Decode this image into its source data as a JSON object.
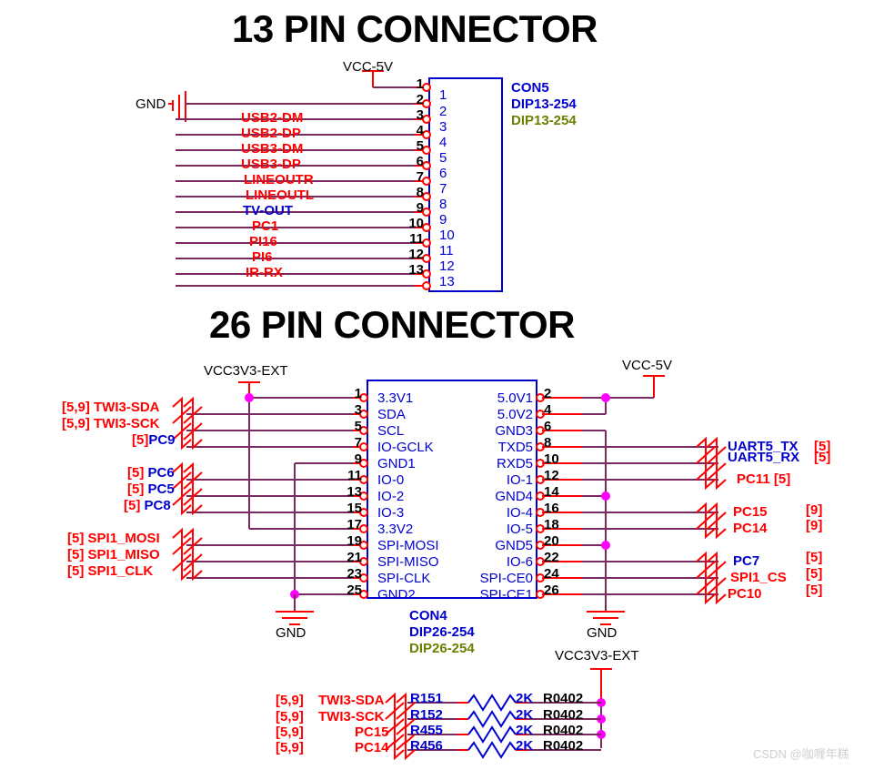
{
  "sheet": {
    "watermark": "CSDN @咖喱年糕",
    "titles": {
      "connector13": "13 PIN CONNECTOR",
      "connector26": "26 PIN CONNECTOR"
    }
  },
  "connector13": {
    "designator": "CON5",
    "part": "DIP13-254",
    "footprint": "DIP13-254",
    "power_label": "VCC-5V",
    "gnd_label": "GND",
    "pins": [
      {
        "num": "1",
        "inner": "1",
        "net": "",
        "net_color": "red"
      },
      {
        "num": "2",
        "inner": "2",
        "net": "",
        "net_color": "red"
      },
      {
        "num": "3",
        "inner": "3",
        "net": "USB2-DM",
        "net_color": "red"
      },
      {
        "num": "4",
        "inner": "4",
        "net": "USB2-DP",
        "net_color": "red"
      },
      {
        "num": "5",
        "inner": "5",
        "net": "USB3-DM",
        "net_color": "red"
      },
      {
        "num": "6",
        "inner": "6",
        "net": "USB3-DP",
        "net_color": "red"
      },
      {
        "num": "7",
        "inner": "7",
        "net": "LINEOUTR",
        "net_color": "red"
      },
      {
        "num": "8",
        "inner": "8",
        "net": "LINEOUTL",
        "net_color": "red"
      },
      {
        "num": "9",
        "inner": "9",
        "net": "TV-OUT",
        "net_color": "blue"
      },
      {
        "num": "10",
        "inner": "10",
        "net": "PC1",
        "net_color": "red"
      },
      {
        "num": "11",
        "inner": "11",
        "net": "PI16",
        "net_color": "red"
      },
      {
        "num": "12",
        "inner": "12",
        "net": "PI6",
        "net_color": "red"
      },
      {
        "num": "13",
        "inner": "13",
        "net": "IR-RX",
        "net_color": "red"
      }
    ]
  },
  "connector26": {
    "designator": "CON4",
    "part": "DIP26-254",
    "footprint": "DIP26-254",
    "power_left_label": "VCC3V3-EXT",
    "power_right_label": "VCC-5V",
    "gnd_left_label": "GND",
    "gnd_right_label": "GND",
    "left_pins": [
      {
        "num": "1",
        "name": "3.3V1"
      },
      {
        "num": "3",
        "name": "SDA"
      },
      {
        "num": "5",
        "name": "SCL"
      },
      {
        "num": "7",
        "name": "IO-GCLK"
      },
      {
        "num": "9",
        "name": "GND1"
      },
      {
        "num": "11",
        "name": "IO-0"
      },
      {
        "num": "13",
        "name": "IO-2"
      },
      {
        "num": "15",
        "name": "IO-3"
      },
      {
        "num": "17",
        "name": "3.3V2"
      },
      {
        "num": "19",
        "name": "SPI-MOSI"
      },
      {
        "num": "21",
        "name": "SPI-MISO"
      },
      {
        "num": "23",
        "name": "SPI-CLK"
      },
      {
        "num": "25",
        "name": "GND2"
      }
    ],
    "right_pins": [
      {
        "num": "2",
        "name": "5.0V1"
      },
      {
        "num": "4",
        "name": "5.0V2"
      },
      {
        "num": "6",
        "name": "GND3"
      },
      {
        "num": "8",
        "name": "TXD5"
      },
      {
        "num": "10",
        "name": "RXD5"
      },
      {
        "num": "12",
        "name": "IO-1"
      },
      {
        "num": "14",
        "name": "GND4"
      },
      {
        "num": "16",
        "name": "IO-4"
      },
      {
        "num": "18",
        "name": "IO-5"
      },
      {
        "num": "20",
        "name": "GND5"
      },
      {
        "num": "22",
        "name": "IO-6"
      },
      {
        "num": "24",
        "name": "SPI-CE0"
      },
      {
        "num": "26",
        "name": "SPI-CE1"
      }
    ],
    "left_nets": [
      {
        "ref": "[5,9]",
        "name": "TWI3-SDA",
        "name_color": "red",
        "pin": "3"
      },
      {
        "ref": "[5,9]",
        "name": "TWI3-SCK",
        "name_color": "red",
        "pin": "5"
      },
      {
        "ref": "[5]",
        "name": "PC9",
        "name_color": "blue",
        "pin": "7"
      },
      {
        "ref": "[5]",
        "name": "PC6",
        "name_color": "blue",
        "pin": "11"
      },
      {
        "ref": "[5]",
        "name": "PC5",
        "name_color": "blue",
        "pin": "13"
      },
      {
        "ref": "[5]",
        "name": "PC8",
        "name_color": "blue",
        "pin": "15"
      },
      {
        "ref": "[5]",
        "name": "SPI1_MOSI",
        "name_color": "red",
        "pin": "19"
      },
      {
        "ref": "[5]",
        "name": "SPI1_MISO",
        "name_color": "red",
        "pin": "21"
      },
      {
        "ref": "[5]",
        "name": "SPI1_CLK",
        "name_color": "red",
        "pin": "23"
      }
    ],
    "right_nets": [
      {
        "name": "UART5_TX",
        "name_color": "blue",
        "ref": "[5]",
        "pin": "8"
      },
      {
        "name": "UART5_RX",
        "name_color": "blue",
        "ref": "[5]",
        "pin": "10"
      },
      {
        "name": "PC11 [5]",
        "name_color": "red",
        "ref": "",
        "pin": "12"
      },
      {
        "name": "PC15",
        "name_color": "red",
        "ref": "[9]",
        "pin": "16"
      },
      {
        "name": "PC14",
        "name_color": "red",
        "ref": "[9]",
        "pin": "18"
      },
      {
        "name": "PC7",
        "name_color": "blue",
        "ref": "[5]",
        "pin": "22"
      },
      {
        "name": "SPI1_CS",
        "name_color": "red",
        "ref": "[5]",
        "pin": "24"
      },
      {
        "name": "PC10",
        "name_color": "red",
        "ref": "[5]",
        "pin": "26"
      }
    ]
  },
  "pullups": {
    "power_label": "VCC3V3-EXT",
    "rows": [
      {
        "ref": "[5,9]",
        "net": "TWI3-SDA",
        "desig": "R151",
        "value": "2K",
        "footprint": "R0402"
      },
      {
        "ref": "[5,9]",
        "net": "TWI3-SCK",
        "desig": "R152",
        "value": "2K",
        "footprint": "R0402"
      },
      {
        "ref": "[5,9]",
        "net": "PC15",
        "desig": "R455",
        "value": "2K",
        "footprint": "R0402"
      },
      {
        "ref": "[5,9]",
        "net": "PC14",
        "desig": "R456",
        "value": "2K",
        "footprint": "R0402"
      }
    ]
  }
}
